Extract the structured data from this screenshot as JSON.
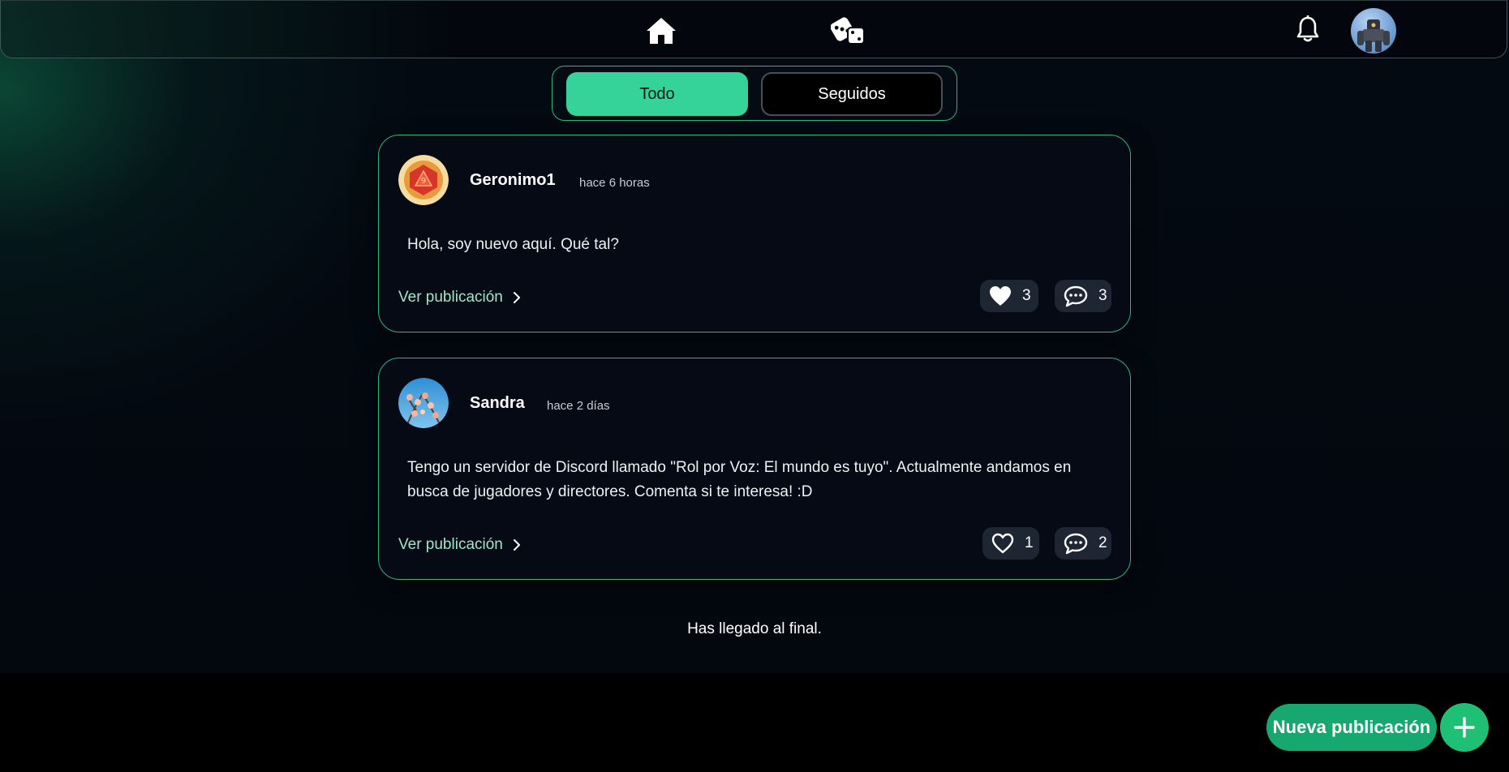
{
  "nav": {
    "icons": [
      "home-icon",
      "dice-icon",
      "bell-icon",
      "user-avatar"
    ]
  },
  "tabs": {
    "all": "Todo",
    "following": "Seguidos",
    "active": "all"
  },
  "posts": [
    {
      "author": "Geronimo1",
      "time": "hace 6 horas",
      "body": "Hola, soy nuevo aquí. Qué tal?",
      "link": "Ver publicación",
      "likes": "3",
      "comments": "3",
      "liked": true
    },
    {
      "author": "Sandra",
      "time": "hace 2 días",
      "body": "Tengo un servidor de Discord llamado \"Rol por Voz: El mundo es tuyo\". Actualmente andamos en busca de jugadores y directores. Comenta si te interesa! :D",
      "link": "Ver publicación",
      "likes": "1",
      "comments": "2",
      "liked": false
    }
  ],
  "end_message": "Has llegado al final.",
  "new_post_label": "Nueva publicación",
  "colors": {
    "accent": "#35d399",
    "button": "#17a870",
    "link": "#9fe7c6",
    "card_bg": "#050a14"
  }
}
